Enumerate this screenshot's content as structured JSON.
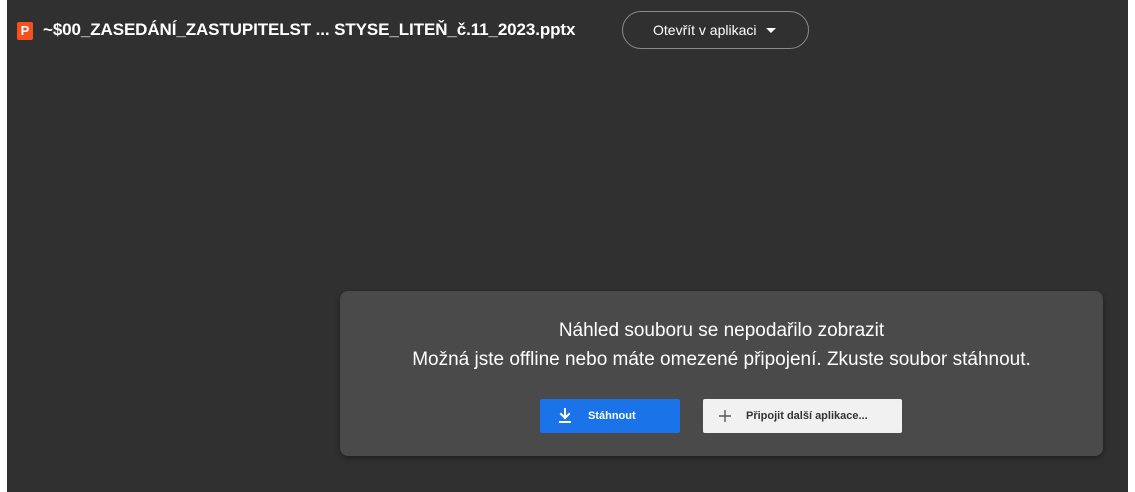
{
  "header": {
    "file_icon_letter": "P",
    "file_name": "~$00_ZASEDÁNÍ_ZASTUPITELST ... STYSE_LITEŇ_č.11_2023.pptx",
    "open_in_app_label": "Otevřít v aplikaci",
    "open_in_app_icon": "caret-down-icon"
  },
  "dialog": {
    "title": "Náhled souboru se nepodařilo zobrazit",
    "message": "Možná jste offline nebo máte omezené připojení. Zkuste soubor stáhnout.",
    "download_label": "Stáhnout",
    "download_icon": "download-icon",
    "connect_label": "Připojit další aplikace...",
    "connect_icon": "plus-icon"
  },
  "colors": {
    "background": "#303030",
    "dialog_background": "#4a4a4a",
    "primary_button": "#1a73e8",
    "secondary_button": "#f1f1f1",
    "file_icon": "#f4511e"
  }
}
